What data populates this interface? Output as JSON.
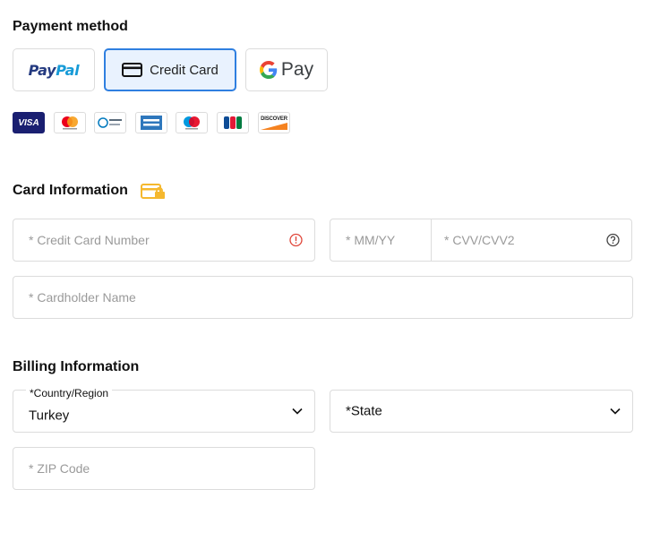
{
  "payment": {
    "title": "Payment method",
    "options": [
      {
        "id": "paypal",
        "label_part1": "Pay",
        "label_part2": "Pal",
        "selected": false
      },
      {
        "id": "credit-card",
        "label": "Credit Card",
        "selected": true
      },
      {
        "id": "google-pay",
        "label": "Pay",
        "selected": false
      }
    ],
    "card_brands": [
      "visa",
      "mastercard",
      "diners-club",
      "american-express",
      "maestro",
      "jcb",
      "discover"
    ],
    "visa_text": "VISA",
    "jcb_text": "JCB",
    "discover_text": "DISCOVER",
    "amex_text": "AMERICAN EXPRESS",
    "diners_text": "Diners Club International"
  },
  "card_info": {
    "title": "Card Information",
    "card_number_placeholder": "* Credit Card Number",
    "expiry_placeholder": "* MM/YY",
    "cvv_placeholder": "* CVV/CVV2",
    "cardholder_placeholder": "* Cardholder Name"
  },
  "billing": {
    "title": "Billing Information",
    "country_label": "*Country/Region",
    "country_value": "Turkey",
    "state_value": "*State",
    "zip_placeholder": "* ZIP Code"
  },
  "colors": {
    "accent": "#2f7fe0",
    "selected_bg": "#e9f2fe",
    "border": "#dcdcdc",
    "placeholder": "#9a9a9a",
    "error": "#e0463a",
    "lock_icon": "#f5b82e"
  }
}
